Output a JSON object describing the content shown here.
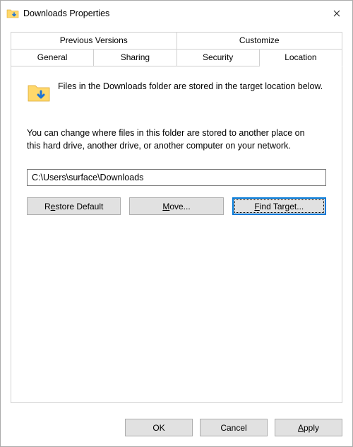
{
  "title": "Downloads Properties",
  "tabs": {
    "row1": [
      "Previous Versions",
      "Customize"
    ],
    "row2": [
      "General",
      "Sharing",
      "Security",
      "Location"
    ],
    "active": "Location"
  },
  "location": {
    "desc1": "Files in the Downloads folder are stored in the target location below.",
    "desc2": "You can change where files in this folder are stored to another place on this hard drive, another drive, or another computer on your network.",
    "path": "C:\\Users\\surface\\Downloads",
    "restore_pre": "R",
    "restore_u": "e",
    "restore_post": "store Default",
    "move_pre": "",
    "move_u": "M",
    "move_post": "ove...",
    "find_pre": "",
    "find_u": "F",
    "find_post": "ind Target..."
  },
  "buttons": {
    "ok": "OK",
    "cancel": "Cancel",
    "apply_pre": "",
    "apply_u": "A",
    "apply_post": "pply"
  }
}
